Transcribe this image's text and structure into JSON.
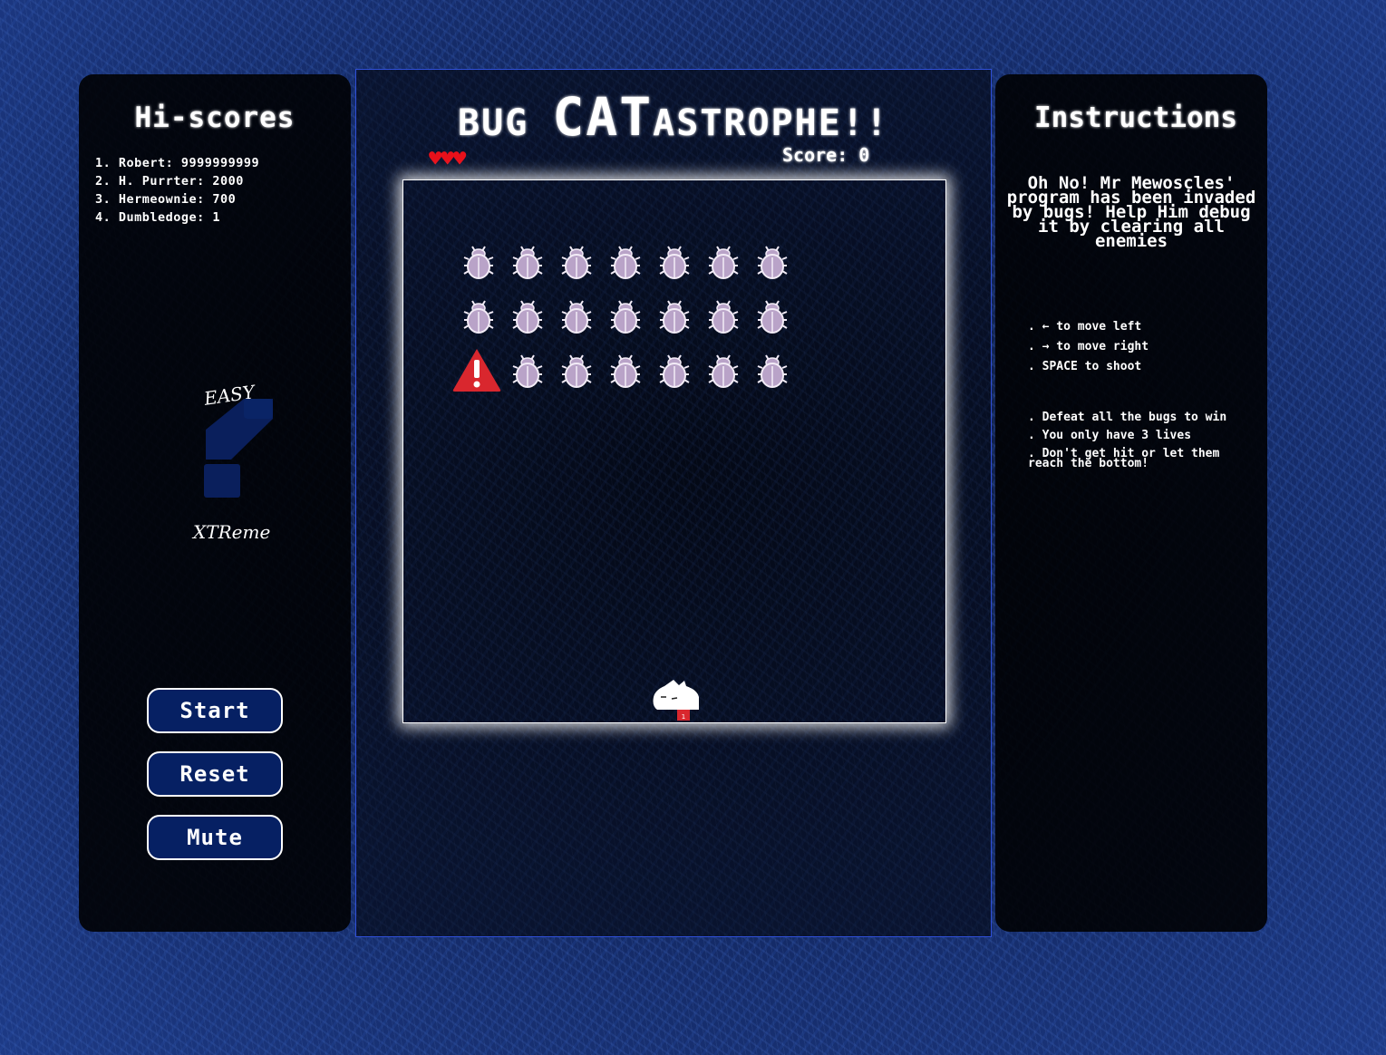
{
  "hiscores": {
    "title": "Hi-scores",
    "entries": [
      "1. Robert: 9999999999",
      "2. H. Purrter: 2000",
      "3. Hermeownie: 700",
      "4. Dumbledoge: 1"
    ]
  },
  "difficulty": {
    "top_label": "EASY",
    "bottom_label": "XTReme"
  },
  "buttons": {
    "start": "Start",
    "reset": "Reset",
    "mute": "Mute"
  },
  "game": {
    "title_part1": "BUG ",
    "title_part2": "CAT",
    "title_part3": "ASTROPHE!!",
    "lives": "♥♥♥",
    "score_text": "Score: 0"
  },
  "instructions": {
    "title": "Instructions",
    "intro": "Oh No! Mr Mewoscles' program has been invaded by bugs! Help Him debug it by clearing all enemies",
    "controls": [
      "← to move left",
      "→ to move right",
      "SPACE to shoot"
    ],
    "rules": [
      "Defeat all the bugs to win",
      "You only have 3 lives",
      "Don't get hit or let them reach the bottom!"
    ]
  },
  "colors": {
    "panel": "#000000",
    "button_bg": "#062063",
    "heart": "#e8101a",
    "warning": "#d9272e",
    "bug": "#b9a3c8"
  }
}
